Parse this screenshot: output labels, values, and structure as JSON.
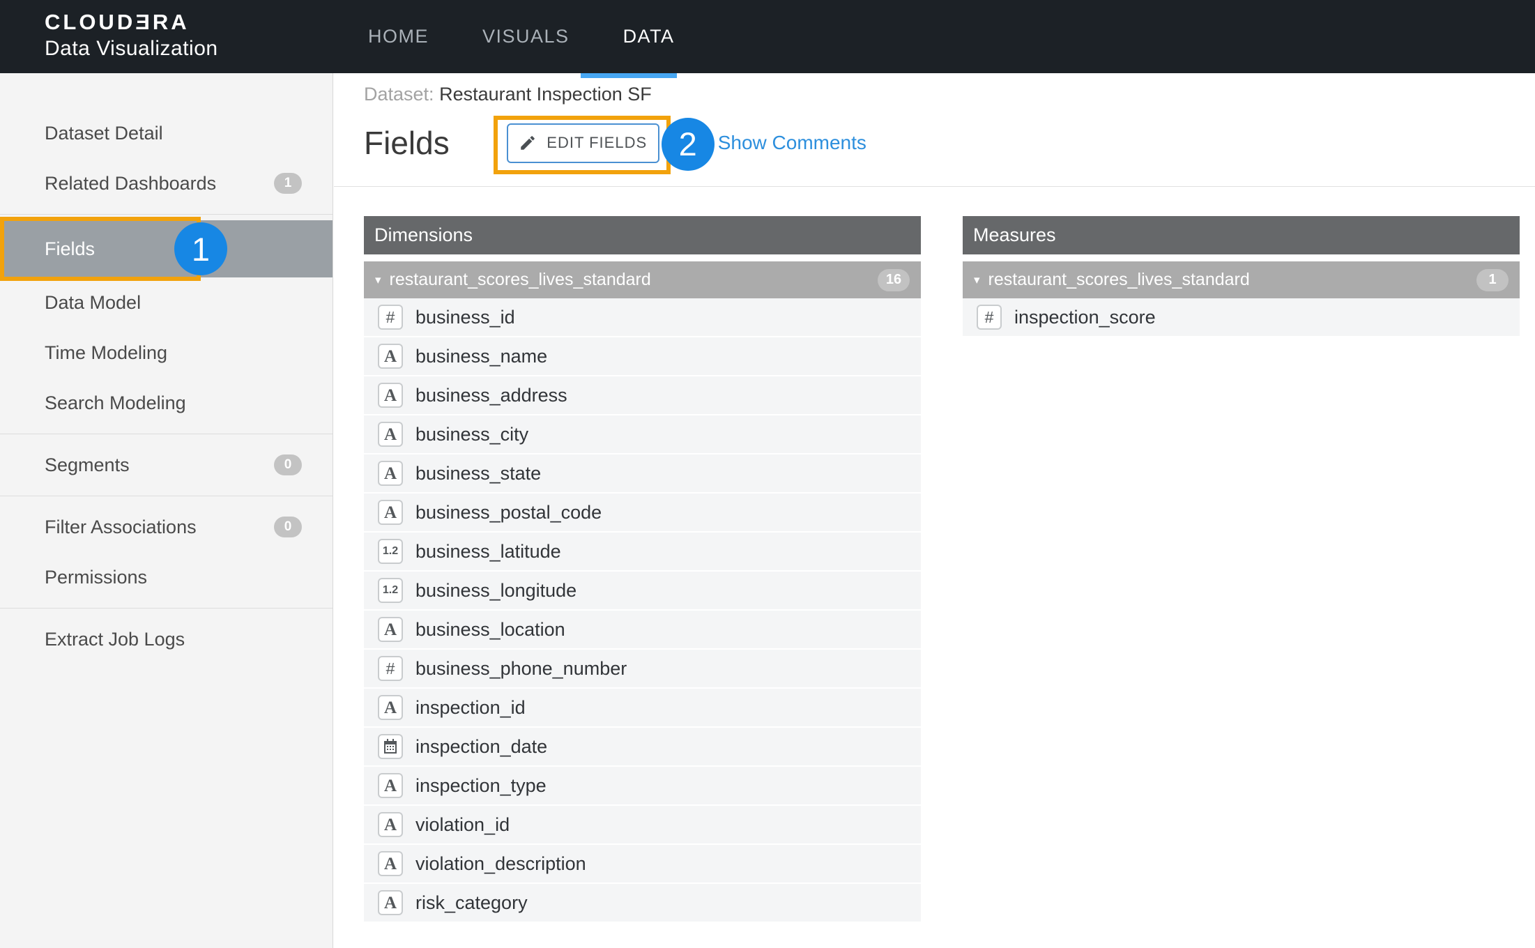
{
  "colors": {
    "topbar": "#1c2126",
    "tabblue": "#47a7f3",
    "orange": "#f2a20c",
    "annblue": "#1787e4",
    "link": "#2d8fdd"
  },
  "app": {
    "logo_top": "CLOUDƎRA",
    "logo_bottom": "Data Visualization"
  },
  "nav": {
    "items": [
      {
        "label": "HOME"
      },
      {
        "label": "VISUALS"
      },
      {
        "label": "DATA"
      }
    ]
  },
  "sidebar": {
    "items": [
      {
        "label": "Dataset Detail"
      },
      {
        "label": "Related Dashboards",
        "badge": "1"
      },
      {
        "label": "Fields"
      },
      {
        "label": "Data Model"
      },
      {
        "label": "Time Modeling"
      },
      {
        "label": "Search Modeling"
      },
      {
        "label": "Segments",
        "badge": "0"
      },
      {
        "label": "Filter Associations",
        "badge": "0"
      },
      {
        "label": "Permissions"
      },
      {
        "label": "Extract Job Logs"
      }
    ]
  },
  "page": {
    "dataset_label": "Dataset:",
    "dataset_name": "Restaurant Inspection SF",
    "title": "Fields",
    "edit_button": "EDIT FIELDS",
    "show_comments": "Show Comments"
  },
  "annotations": {
    "step1": "1",
    "step2": "2"
  },
  "icon_glyphs": {
    "integer": "#",
    "string": "A",
    "decimal": "1.2",
    "date": ""
  },
  "dimensions": {
    "title": "Dimensions",
    "group": {
      "name": "restaurant_scores_lives_standard",
      "count": "16"
    },
    "fields": [
      {
        "name": "business_id",
        "icon": "integer"
      },
      {
        "name": "business_name",
        "icon": "string"
      },
      {
        "name": "business_address",
        "icon": "string"
      },
      {
        "name": "business_city",
        "icon": "string"
      },
      {
        "name": "business_state",
        "icon": "string"
      },
      {
        "name": "business_postal_code",
        "icon": "string"
      },
      {
        "name": "business_latitude",
        "icon": "decimal"
      },
      {
        "name": "business_longitude",
        "icon": "decimal"
      },
      {
        "name": "business_location",
        "icon": "string"
      },
      {
        "name": "business_phone_number",
        "icon": "integer"
      },
      {
        "name": "inspection_id",
        "icon": "string"
      },
      {
        "name": "inspection_date",
        "icon": "date"
      },
      {
        "name": "inspection_type",
        "icon": "string"
      },
      {
        "name": "violation_id",
        "icon": "string"
      },
      {
        "name": "violation_description",
        "icon": "string"
      },
      {
        "name": "risk_category",
        "icon": "string"
      }
    ]
  },
  "measures": {
    "title": "Measures",
    "group": {
      "name": "restaurant_scores_lives_standard",
      "count": "1"
    },
    "fields": [
      {
        "name": "inspection_score",
        "icon": "integer"
      }
    ]
  }
}
